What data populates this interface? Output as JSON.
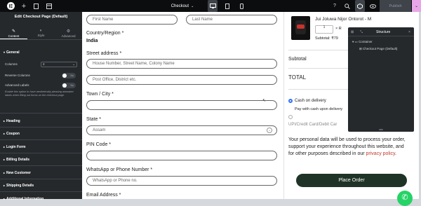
{
  "topbar": {
    "page_label": "Checkout",
    "publish_label": "Publish"
  },
  "panel": {
    "title": "Edit Checkout Page (Default)",
    "tabs": [
      {
        "icon": "pencil-icon",
        "label": "Content"
      },
      {
        "icon": "half-circle-icon",
        "label": "Style"
      },
      {
        "icon": "gear-icon",
        "label": "Advanced"
      }
    ],
    "general_label": "General",
    "columns_label": "Columns",
    "columns_value": "2",
    "reverse_columns_label": "Reverse Columns",
    "reverse_columns_state": "No",
    "advanced_labels_label": "Advanced Labels",
    "advanced_labels_state": "No",
    "advanced_labels_help": "Enable this option to have aesthetically pleasing animated labels when filling out forms on the checkout page.",
    "sections": [
      "Heading",
      "Coupon",
      "Login Form",
      "Billing Details",
      "New Customer",
      "Shipping Details",
      "Additional Information"
    ]
  },
  "form": {
    "first_name_placeholder": "First Name",
    "last_name_placeholder": "Last Name",
    "country_label": "Country/Region *",
    "country_value": "India",
    "street_label": "Street address *",
    "street_placeholder": "House Number, Street Name, Colony Name",
    "street2_placeholder": "Post Office, District etc.",
    "town_label": "Town / City *",
    "state_label": "State *",
    "state_value": "Assam",
    "pin_label": "PIN Code *",
    "whatsapp_label": "WhatsApp or Phone Number *",
    "whatsapp_placeholder": "WhatsApp or Phone no.",
    "email_label": "Email Address *"
  },
  "summary": {
    "product_name": "Jui Joluwa Nijor Ontorot - M",
    "qty_label": "1",
    "remove_symbol": "× R",
    "subtotal_line": "Subtotal: ₹79",
    "subtotal_label": "Subtotal",
    "total_label": "TOTAL",
    "cod_label": "Cash on delivery",
    "cod_desc": "Pay with cash upon delivery",
    "upi_label": "UPI/Credit Card/Debit Car",
    "privacy_text_1": "Your personal data will be used to process your order, support your experience throughout this website, and for other purposes described in our ",
    "privacy_link": "privacy policy",
    "privacy_text_2": ".",
    "place_order_label": "Place Order"
  },
  "structure": {
    "title": "Structure",
    "container_label": "Container",
    "page_label": "Checkout Page (Default)"
  },
  "colors": {
    "topbar_bg": "#0c0d0e",
    "panel_bg": "#26292c",
    "place_order_bg": "#1f3327",
    "privacy_link": "#c0392b",
    "whatsapp": "#25d366",
    "publish_bg": "#e8a6e8"
  }
}
